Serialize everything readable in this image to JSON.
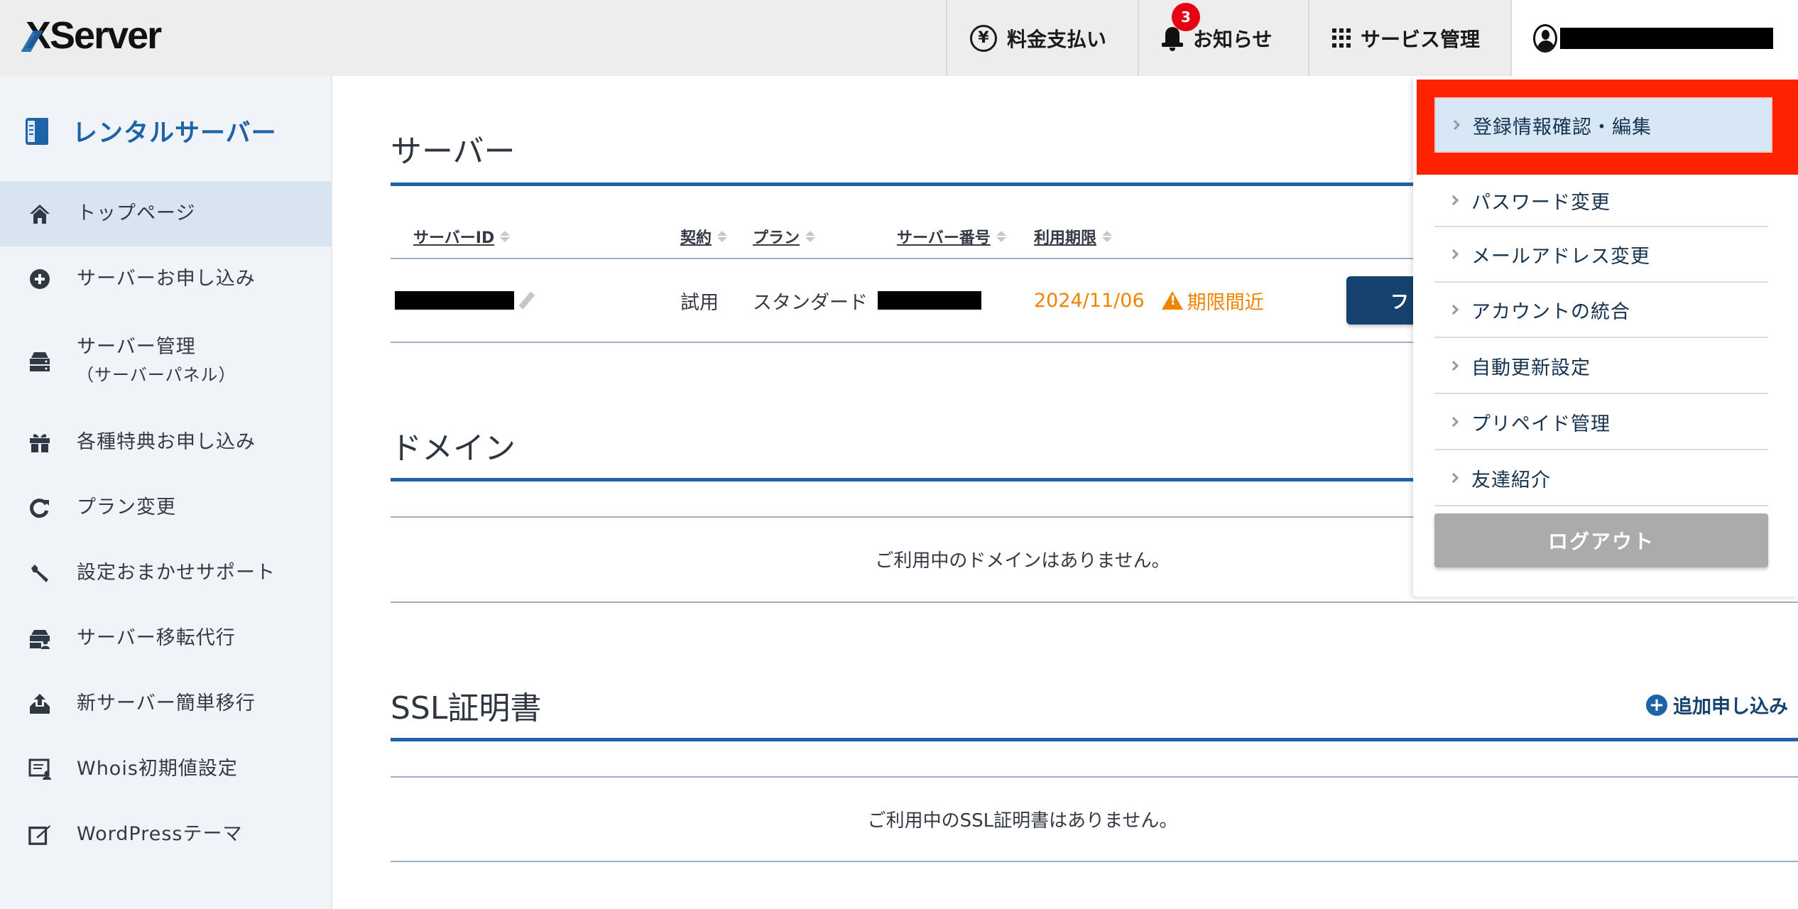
{
  "header": {
    "logo": "XServer",
    "nav": [
      {
        "label": "料金支払い",
        "icon": "yen-icon"
      },
      {
        "label": "お知らせ",
        "icon": "bell-icon",
        "badge": "3"
      },
      {
        "label": "サービス管理",
        "icon": "grid-icon"
      }
    ],
    "user": {
      "icon": "user-icon",
      "name": "[redacted]"
    }
  },
  "sidebar": {
    "brand": "レンタルサーバー",
    "items": [
      {
        "label": "トップページ",
        "icon": "home-icon",
        "active": true
      },
      {
        "label": "サーバーお申し込み",
        "icon": "plus-circle-icon"
      },
      {
        "label": "サーバー管理",
        "sub": "（サーバーパネル）",
        "icon": "server-icon"
      },
      {
        "label": "各種特典お申し込み",
        "icon": "gift-icon"
      },
      {
        "label": "プラン変更",
        "icon": "refresh-icon"
      },
      {
        "label": "設定おまかせサポート",
        "icon": "wrench-icon"
      },
      {
        "label": "サーバー移転代行",
        "icon": "server-user-icon"
      },
      {
        "label": "新サーバー簡単移行",
        "icon": "upload-icon"
      },
      {
        "label": "Whois初期値設定",
        "icon": "whois-icon"
      },
      {
        "label": "WordPressテーマ",
        "icon": "theme-edit-icon"
      }
    ]
  },
  "server": {
    "title": "サーバー",
    "columns": [
      "サーバーID",
      "契約",
      "プラン",
      "サーバー番号",
      "利用期限"
    ],
    "rows": [
      {
        "server_id": "[redacted]",
        "contract": "試用",
        "plan": "スタンダード",
        "server_no": "[redacted]",
        "expiry": "2024/11/06",
        "warning": "期限間近",
        "action": "フ"
      }
    ]
  },
  "domain": {
    "title": "ドメイン",
    "empty": "ご利用中のドメインはありません。"
  },
  "ssl": {
    "title": "SSL証明書",
    "add_label": "追加申し込み",
    "empty": "ご利用中のSSL証明書はありません。"
  },
  "account_menu": {
    "items": [
      "登録情報確認・編集",
      "パスワード変更",
      "メールアドレス変更",
      "アカウントの統合",
      "自動更新設定",
      "プリペイド管理",
      "友達紹介"
    ],
    "logout": "ログアウト",
    "highlight_color": "#ff2200"
  },
  "colors": {
    "brand_blue": "#1e63a8",
    "navy": "#15426e",
    "warning_orange": "#f08300",
    "badge_red": "#e50012"
  }
}
